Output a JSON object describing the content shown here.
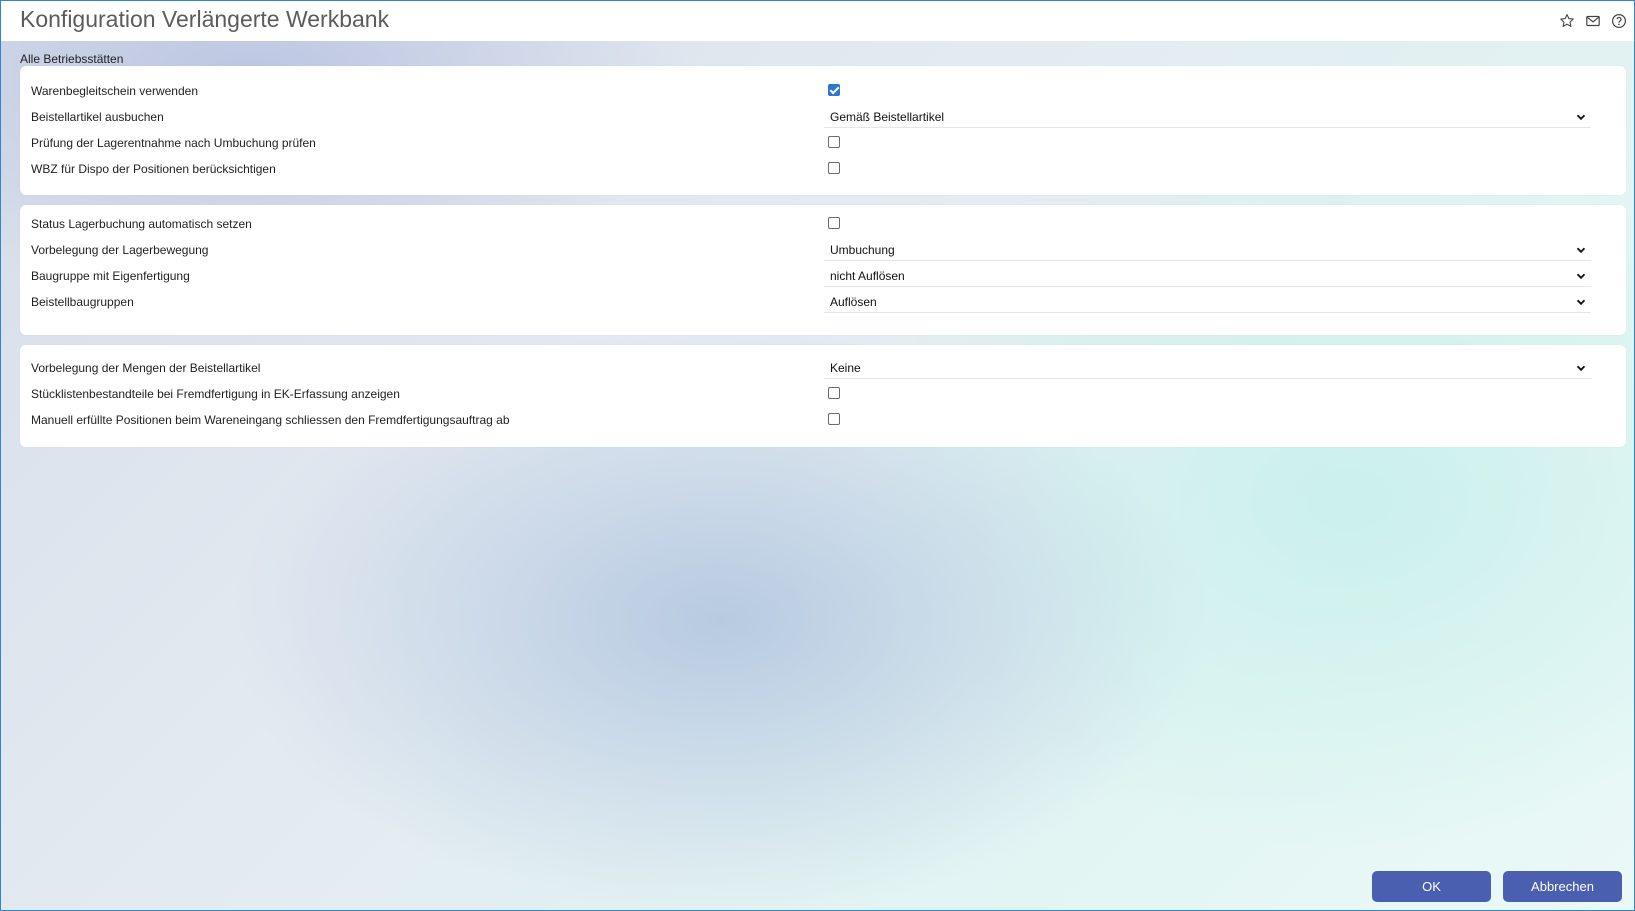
{
  "window": {
    "title": "Konfiguration Verlängerte Werkbank",
    "icons": [
      "star-icon",
      "mail-icon",
      "help-icon"
    ]
  },
  "scope_label": "Alle Betriebsstätten",
  "sections": [
    {
      "rows": [
        {
          "label": "Warenbegleitschein verwenden",
          "type": "checkbox",
          "checked": true
        },
        {
          "label": "Beistellartikel ausbuchen",
          "type": "select",
          "value": "Gemäß Beistellartikel"
        },
        {
          "label": "Prüfung der Lagerentnahme nach Umbuchung prüfen",
          "type": "checkbox",
          "checked": false
        },
        {
          "label": "WBZ für Dispo der Positionen berücksichtigen",
          "type": "checkbox",
          "checked": false
        }
      ]
    },
    {
      "rows": [
        {
          "label": "Status Lagerbuchung automatisch setzen",
          "type": "checkbox",
          "checked": false
        },
        {
          "label": "Vorbelegung der Lagerbewegung",
          "type": "select",
          "value": "Umbuchung"
        },
        {
          "label": "Baugruppe mit Eigenfertigung",
          "type": "select",
          "value": "nicht Auflösen"
        },
        {
          "label": "Beistellbaugruppen",
          "type": "select",
          "value": "Auflösen"
        }
      ]
    },
    {
      "rows": [
        {
          "label": "Vorbelegung der Mengen der Beistellartikel",
          "type": "select",
          "value": "Keine"
        },
        {
          "label": "Stücklistenbestandteile bei Fremdfertigung in EK-Erfassung anzeigen",
          "type": "checkbox",
          "checked": false
        },
        {
          "label": "Manuell erfüllte Positionen beim Wareneingang schliessen den Fremdfertigungsauftrag ab",
          "type": "checkbox",
          "checked": false
        }
      ]
    }
  ],
  "buttons": {
    "ok": "OK",
    "cancel": "Abbrechen"
  },
  "colors": {
    "primary_button": "#4a5fb0",
    "checkbox_checked": "#2f74d8",
    "title_text": "#5c5c5c"
  }
}
